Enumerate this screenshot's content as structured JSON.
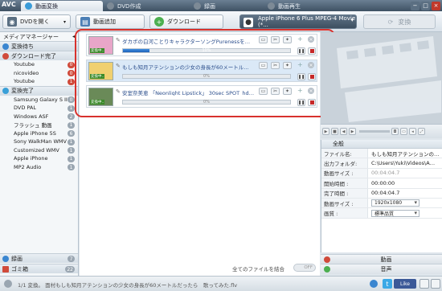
{
  "app": {
    "logo": "AVC"
  },
  "tabs": [
    {
      "label": "動画変換",
      "color": "#3a9bd8",
      "active": true
    },
    {
      "label": "DVD作成",
      "color": "#7d8a96",
      "active": false
    },
    {
      "label": "録画",
      "color": "#7d8a96",
      "active": false
    },
    {
      "label": "動画再生",
      "color": "#7d8a96",
      "active": false
    }
  ],
  "window_controls": {
    "minimize": "−",
    "maximize": "□",
    "close": "×"
  },
  "toolbar": {
    "open_dvd": "DVDを開く",
    "add_video": "動画追加",
    "download": "ダウンロード",
    "profile": "Apple iPhone 6 Plus MPEG-4 Movie (*...",
    "convert": "変換"
  },
  "sidebar": {
    "header": "メディアマネージャー",
    "groups": [
      {
        "label": "変換待ち",
        "color": "#3a86d0",
        "items": []
      },
      {
        "label": "ダウンロード完了",
        "color": "#d04a3a",
        "items": [
          {
            "label": "Youtube",
            "count": "0"
          },
          {
            "label": "nicovideo",
            "count": "0"
          },
          {
            "label": "Youtube",
            "count": "1"
          }
        ]
      },
      {
        "label": "変換完了",
        "color": "#3aa0d8",
        "items": [
          {
            "label": "Samsung Galaxy S III",
            "count": "0"
          },
          {
            "label": "DVD PAL",
            "count": "1"
          },
          {
            "label": "Windows ASF",
            "count": "2"
          },
          {
            "label": "フラッシュ 動画",
            "count": "1"
          },
          {
            "label": "Apple iPhone 5S",
            "count": "6"
          },
          {
            "label": "Sony WalkMan WMV",
            "count": "1"
          },
          {
            "label": "Customized WMV",
            "count": "1"
          },
          {
            "label": "Apple iPhone",
            "count": "1"
          },
          {
            "label": "MP2 Audio",
            "count": "1"
          }
        ]
      }
    ],
    "bottom": [
      {
        "label": "録画",
        "count": "7"
      },
      {
        "label": "ゴミ箱",
        "count": "22"
      }
    ]
  },
  "tasks": [
    {
      "title": "ダカポの白河ことりキャラクターソングPurenessを…",
      "progress_label": "10%",
      "progress": 0.16,
      "thumb_label": "変換中..",
      "thumb_color": "#e8a6c8",
      "selected": false
    },
    {
      "title": "もしも知月アテンションの少女の身長が60メートル…",
      "progress_label": "0%",
      "progress": 0.0,
      "thumb_label": "変換中..",
      "thumb_color": "#f0d070",
      "selected": true
    },
    {
      "title": "安室奈美恵 「Neonlight Lipstick」 30sec SPOT_hd…",
      "progress_label": "0%",
      "progress": 0.0,
      "thumb_label": "変換中..",
      "thumb_color": "#6a8a58",
      "selected": false
    }
  ],
  "combine": {
    "label": "全てのファイルを結合",
    "toggle": "OFF"
  },
  "properties": {
    "header": "全般",
    "rows": [
      {
        "key": "ファイル名:",
        "value": "もしも知月アテンションの…"
      },
      {
        "key": "出力フォルダ:",
        "value": "C:\\Users\\Yuki\\Videos\\A…"
      },
      {
        "key": "動画サイズ :",
        "value": "00:04:04.7",
        "gray": true
      },
      {
        "key": "開始時間 :",
        "value": "00:00:00"
      },
      {
        "key": "完了時間 :",
        "value": "00:04:04.7"
      },
      {
        "key": "動画サイズ :",
        "value": "1920x1080",
        "select": true
      },
      {
        "key": "画質 :",
        "value": "標準品質",
        "select": true
      }
    ]
  },
  "panel_bars": {
    "video": "動画",
    "audio": "音声"
  },
  "status": {
    "text": "1/1 変換。 面村もしも知月アテンションの少女の身長が60メートルだったら　歌ってみた.flv"
  },
  "social": {
    "like": "Like"
  }
}
